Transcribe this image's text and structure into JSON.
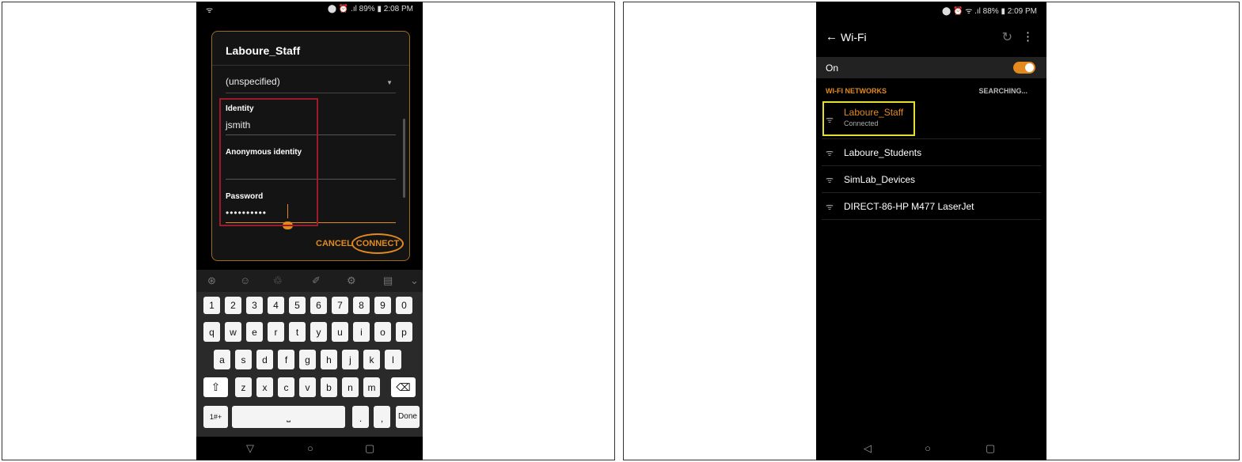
{
  "left": {
    "status": {
      "left": "ᯤ",
      "right": "⬤ ⏰ .ıl 89% ▮ 2:08 PM"
    },
    "dialog": {
      "title": "Laboure_Staff",
      "method_value": "(unspecified)",
      "identity_label": "Identity",
      "identity_value": "jsmith",
      "anon_label": "Anonymous identity",
      "anon_value": "",
      "password_label": "Password",
      "password_value": "••••••••••",
      "cancel": "CANCEL",
      "connect": "CONNECT"
    },
    "keyboard": {
      "toolbar_icons": [
        "⊛",
        "☺",
        "♲",
        "✐",
        "⚙",
        "▤",
        "⌄"
      ],
      "row1": [
        "1",
        "2",
        "3",
        "4",
        "5",
        "6",
        "7",
        "8",
        "9",
        "0"
      ],
      "row2": [
        "q",
        "w",
        "e",
        "r",
        "t",
        "y",
        "u",
        "i",
        "o",
        "p"
      ],
      "row3": [
        "a",
        "s",
        "d",
        "f",
        "g",
        "h",
        "j",
        "k",
        "l"
      ],
      "row4": [
        "z",
        "x",
        "c",
        "v",
        "b",
        "n",
        "m"
      ],
      "shift": "⇧",
      "backspace": "⌫",
      "sym": "1#+",
      "space": "⎵",
      "period": ".",
      "comma": ",",
      "done": "Done"
    },
    "nav": {
      "back": "▽",
      "home": "○",
      "recent": "▢"
    }
  },
  "right": {
    "status": {
      "right": "⬤ ⏰ ᯤ .ıl 88% ▮ 2:09 PM"
    },
    "appbar": {
      "back": "←",
      "title": "Wi-Fi",
      "refresh": "↻",
      "more": "⋮"
    },
    "on_label": "On",
    "section": {
      "title": "WI-FI NETWORKS",
      "status": "SEARCHING..."
    },
    "networks": [
      {
        "name": "Laboure_Staff",
        "status": "Connected",
        "icon": "ᯤ"
      },
      {
        "name": "Laboure_Students",
        "status": "",
        "icon": "ᯤ"
      },
      {
        "name": "SimLab_Devices",
        "status": "",
        "icon": "ᯤ"
      },
      {
        "name": "DIRECT-86-HP M477 LaserJet",
        "status": "",
        "icon": "ᯤ"
      }
    ],
    "nav": {
      "back": "◁",
      "home": "○",
      "recent": "▢"
    }
  },
  "colors": {
    "accent": "#e28a1e",
    "highlight_red": "#9b1b2b",
    "highlight_yellow": "#e6e02a"
  }
}
